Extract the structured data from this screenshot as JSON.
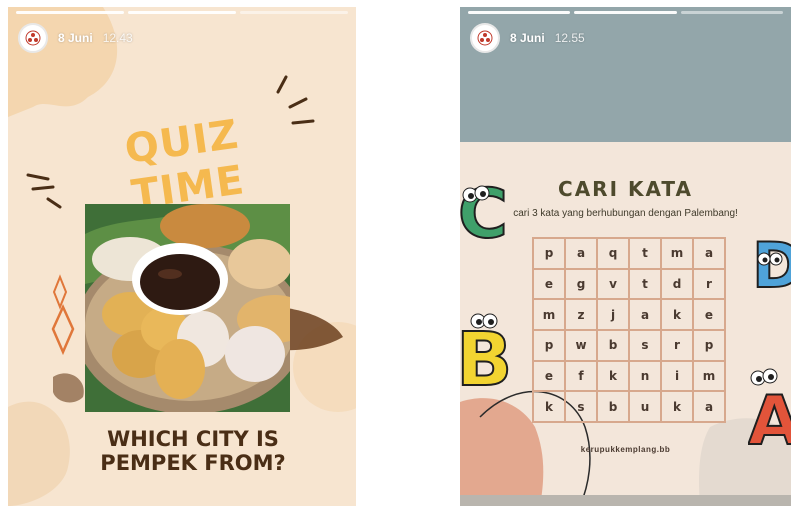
{
  "stories": [
    {
      "date": "8 Juni",
      "time": "12.43",
      "title": "QUIZ TIME",
      "question_line1": "WHICH CITY IS",
      "question_line2": "PEMPEK FROM?"
    },
    {
      "date": "8 Juni",
      "time": "12.55",
      "title": "CARI KATA",
      "subtitle": "cari 3 kata yang berhubungan dengan Palembang!",
      "grid": [
        [
          "p",
          "a",
          "q",
          "t",
          "m",
          "a"
        ],
        [
          "e",
          "g",
          "v",
          "t",
          "d",
          "r"
        ],
        [
          "m",
          "z",
          "j",
          "a",
          "k",
          "e"
        ],
        [
          "p",
          "w",
          "b",
          "s",
          "r",
          "p"
        ],
        [
          "e",
          "f",
          "k",
          "n",
          "i",
          "m"
        ],
        [
          "k",
          "s",
          "b",
          "u",
          "k",
          "a"
        ]
      ],
      "handle": "kerupukkemplang.bb",
      "letters": [
        "C",
        "D",
        "B",
        "A"
      ]
    }
  ],
  "colors": {
    "quiz_title": "#f5b94f",
    "question": "#4a2e16",
    "story1_bg": "#f7e5d0",
    "story2_sky": "#93a6aa",
    "story2_bg": "#f3e6da"
  }
}
